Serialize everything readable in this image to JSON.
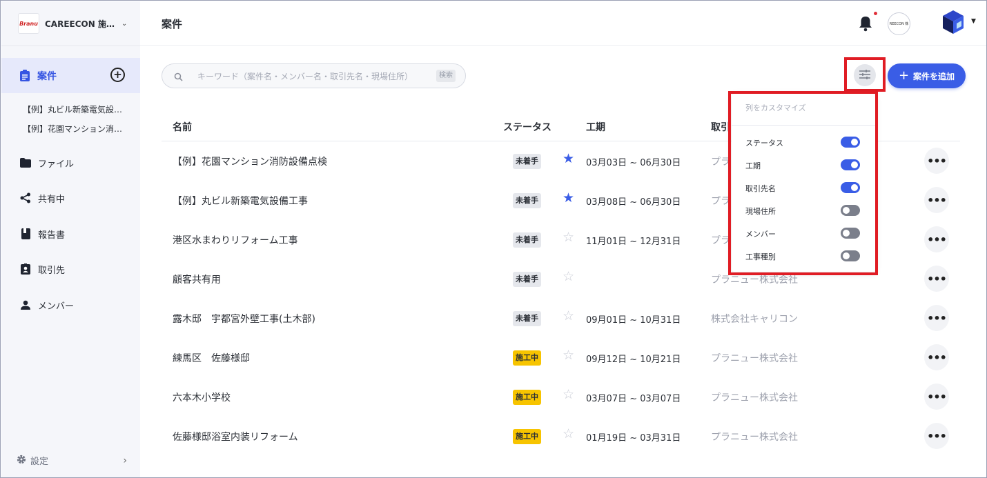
{
  "org": {
    "logo_text": "Branu",
    "name": "CAREECON 施…"
  },
  "sidebar": {
    "active": {
      "label": "案件"
    },
    "recent": [
      "【例】丸ビル新築電気設…",
      "【例】花園マンション消…"
    ],
    "items": [
      {
        "label": "ファイル",
        "icon": "folder-icon"
      },
      {
        "label": "共有中",
        "icon": "share-icon"
      },
      {
        "label": "報告書",
        "icon": "book-icon"
      },
      {
        "label": "取引先",
        "icon": "contact-badge-icon"
      },
      {
        "label": "メンバー",
        "icon": "person-icon"
      }
    ],
    "settings_label": "設定"
  },
  "header": {
    "title": "案件",
    "avatar_text": "REECON 株"
  },
  "search": {
    "placeholder": "キーワード（案件名・メンバー名・取引先名・現場住所）",
    "button": "検索"
  },
  "toolbar": {
    "add_label": "案件を追加"
  },
  "table": {
    "headers": {
      "name": "名前",
      "status": "ステータス",
      "period": "工期",
      "client": "取引"
    },
    "rows": [
      {
        "name": "【例】花園マンション消防設備点検",
        "status": "未着手",
        "starred": true,
        "period": "03月03日 ~ 06月30日",
        "client": "プラ"
      },
      {
        "name": "【例】丸ビル新築電気設備工事",
        "status": "未着手",
        "starred": true,
        "period": "03月08日 ~ 06月30日",
        "client": "プラ"
      },
      {
        "name": "港区水まわりリフォーム工事",
        "status": "未着手",
        "starred": false,
        "period": "11月01日 ~ 12月31日",
        "client": "プラ"
      },
      {
        "name": "顧客共有用",
        "status": "未着手",
        "starred": false,
        "period": "",
        "client": "プラニュー株式会社"
      },
      {
        "name": "露木邸　宇都宮外壁工事(土木部)",
        "status": "未着手",
        "starred": false,
        "period": "09月01日 ~ 10月31日",
        "client": "株式会社キャリコン"
      },
      {
        "name": "練馬区　佐藤様邸",
        "status": "施工中",
        "starred": false,
        "period": "09月12日 ~ 10月21日",
        "client": "プラニュー株式会社"
      },
      {
        "name": "六本木小学校",
        "status": "施工中",
        "starred": false,
        "period": "03月07日 ~ 03月07日",
        "client": "プラニュー株式会社"
      },
      {
        "name": "佐藤様邸浴室内装リフォーム",
        "status": "施工中",
        "starred": false,
        "period": "01月19日 ~ 03月31日",
        "client": "プラニュー株式会社"
      }
    ]
  },
  "customize": {
    "title": "列をカスタマイズ",
    "options": [
      {
        "label": "ステータス",
        "on": true
      },
      {
        "label": "工期",
        "on": true
      },
      {
        "label": "取引先名",
        "on": true
      },
      {
        "label": "現場住所",
        "on": false
      },
      {
        "label": "メンバー",
        "on": false
      },
      {
        "label": "工事種別",
        "on": false
      }
    ]
  },
  "colors": {
    "accent": "#3a5de6",
    "highlight": "#e01c24",
    "in_progress": "#f7c400"
  }
}
